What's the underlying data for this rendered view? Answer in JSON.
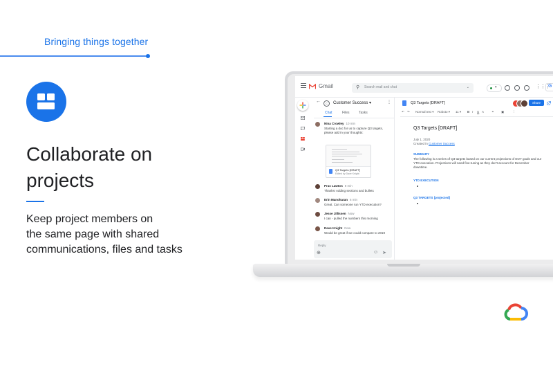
{
  "slide": {
    "eyebrow": "Bringing things together",
    "headline_line1": "Collaborate on",
    "headline_line2": "projects",
    "body_line1": "Keep project members on",
    "body_line2": "the same page with shared",
    "body_line3": "communications, files and tasks",
    "feature_icon": "tasks-board-icon",
    "brand_logo": "google-cloud-logo"
  },
  "colors": {
    "accent": "#1a73e8",
    "text": "#202124",
    "google_blue": "#4285f4",
    "google_red": "#ea4335",
    "google_yellow": "#fbbc04",
    "google_green": "#34a853"
  },
  "gmail": {
    "app_name": "Gmail",
    "search_placeholder": "Search mail and chat",
    "account_initial": "G",
    "rail_icons": [
      "compose-icon",
      "mail-icon",
      "chat-icon",
      "rooms-icon",
      "meet-icon"
    ]
  },
  "chat": {
    "room_title": "Customer Success",
    "tabs": [
      "Chat",
      "Files",
      "Tasks"
    ],
    "active_tab": "Chat",
    "messages": [
      {
        "name": "Nina Crowley",
        "time": "10 min",
        "lines": [
          "Starting a doc for us to capture Q3 targets,",
          "please add in your thoughts:"
        ]
      },
      {
        "name": "Pras Lawton",
        "time": "8 min",
        "lines": [
          "Thanks! Adding sections and bullets"
        ]
      },
      {
        "name": "Erin Manoharan",
        "time": "6 min",
        "lines": [
          "Great. Can someone run YTD execution?"
        ]
      },
      {
        "name": "Jesse Jillissen",
        "time": "Now",
        "lines": [
          "I can - pulled the numbers this morning"
        ]
      },
      {
        "name": "Dave Knight",
        "time": "Now",
        "lines": [
          "Would be great if we could compare to 2019"
        ]
      }
    ],
    "attachment": {
      "title": "Q3 Targets [DRAFT]",
      "subtitle": "Edited by Dave Knight"
    },
    "reply_placeholder": "Reply"
  },
  "doc": {
    "title": "Q3 Targets [DRAFT]",
    "share_label": "Share",
    "toolbar": {
      "style": "Normal text",
      "font": "Roboto",
      "size": "11",
      "bold": "B",
      "italic": "I",
      "underline": "U"
    },
    "body_title": "Q3 Targets [DRAFT]",
    "date": "July 1, 2020",
    "created_prefix": "Created in",
    "created_link": "Customer Success",
    "summary_heading": "SUMMARY",
    "summary_lines": [
      "The following is a series of Q3 targets based on our current projections of EOY goals and our",
      "YTD execution. Projections will need fine-tuning as they don't account for December",
      "downtime."
    ],
    "ytd_heading": "YTD EXECUTION",
    "q3_heading": "Q3 TARGETS",
    "q3_tag": "[projected]"
  }
}
